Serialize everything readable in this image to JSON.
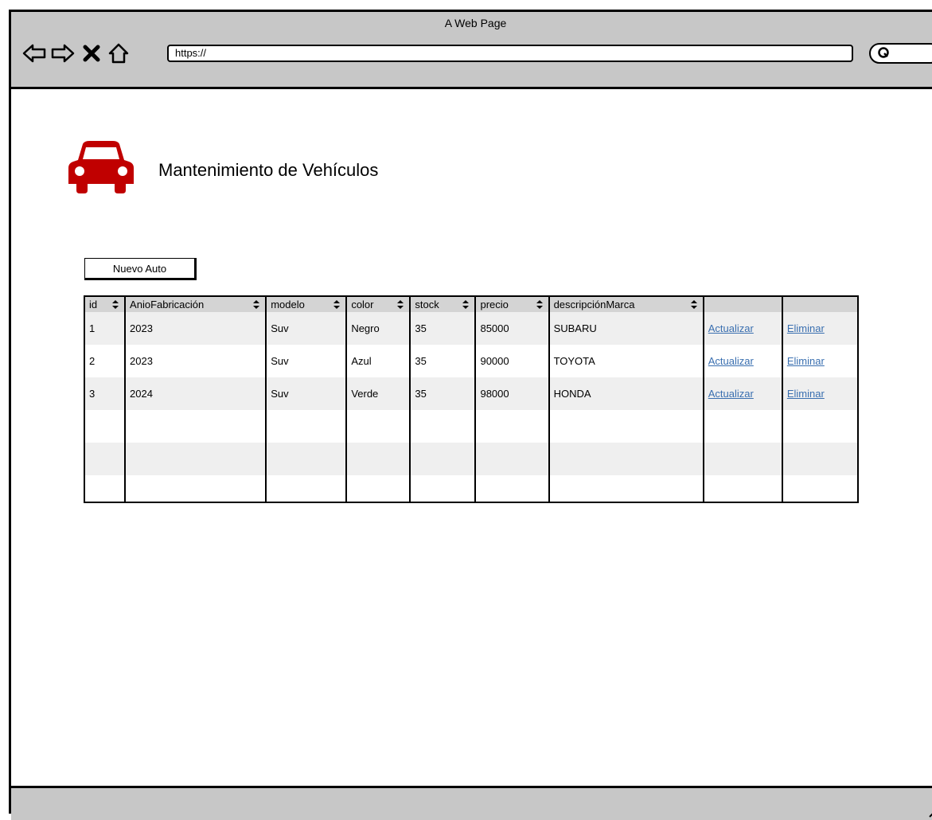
{
  "browser": {
    "title": "A Web Page",
    "url": "https://"
  },
  "page": {
    "title": "Mantenimiento de Vehículos",
    "new_button_label": "Nuevo Auto"
  },
  "colors": {
    "car_icon": "#c00000",
    "link": "#3a6fb0",
    "header_bg": "#d4d4d4",
    "chrome_bg": "#c7c7c7"
  },
  "table": {
    "columns": [
      "id",
      "AnioFabricación",
      "modelo",
      "color",
      "stock",
      "precio",
      "descripciónMarca",
      "",
      ""
    ],
    "rows": [
      {
        "id": "1",
        "anio": "2023",
        "modelo": "Suv",
        "color": "Negro",
        "stock": "35",
        "precio": "85000",
        "marca": "SUBARU",
        "update": "Actualizar",
        "delete": "Eliminar"
      },
      {
        "id": "2",
        "anio": "2023",
        "modelo": "Suv",
        "color": "Azul",
        "stock": "35",
        "precio": "90000",
        "marca": "TOYOTA",
        "update": "Actualizar",
        "delete": "Eliminar"
      },
      {
        "id": "3",
        "anio": "2024",
        "modelo": "Suv",
        "color": "Verde",
        "stock": "35",
        "precio": "98000",
        "marca": "HONDA",
        "update": "Actualizar",
        "delete": "Eliminar"
      }
    ]
  }
}
